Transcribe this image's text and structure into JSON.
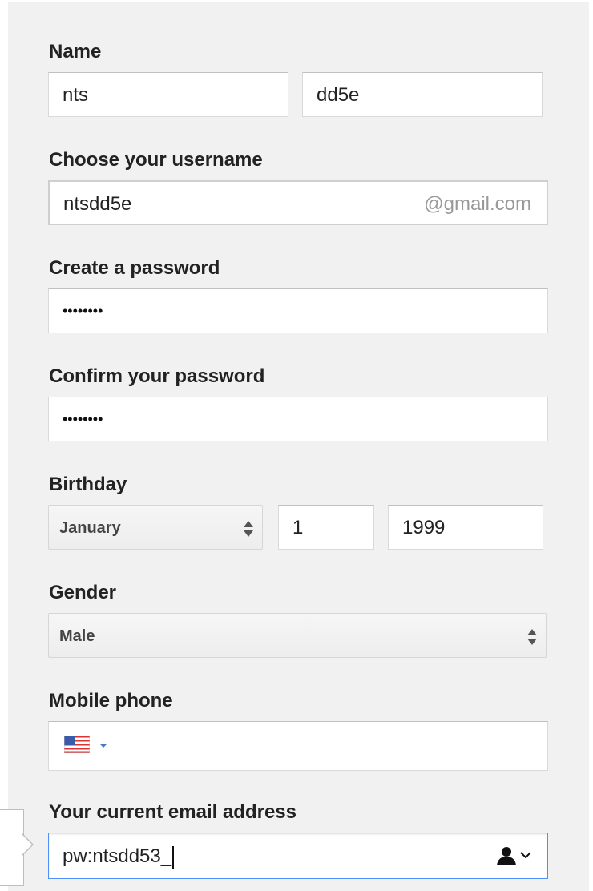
{
  "form": {
    "name": {
      "label": "Name",
      "first": "nts",
      "last": "dd5e"
    },
    "username": {
      "label": "Choose your username",
      "value": "ntsdd5e",
      "suffix": "@gmail.com"
    },
    "password": {
      "label": "Create a password",
      "value": "••••••••"
    },
    "confirm_password": {
      "label": "Confirm your password",
      "value": "••••••••"
    },
    "birthday": {
      "label": "Birthday",
      "month": "January",
      "day": "1",
      "year": "1999"
    },
    "gender": {
      "label": "Gender",
      "value": "Male"
    },
    "mobile_phone": {
      "label": "Mobile phone",
      "country_flag": "us-flag-icon",
      "value": ""
    },
    "current_email": {
      "label": "Your current email address",
      "value": "pw:ntsdd53_"
    }
  },
  "colors": {
    "panel_bg": "#f1f1f1",
    "focus_border": "#4d90fe",
    "suffix_text": "#999999"
  }
}
